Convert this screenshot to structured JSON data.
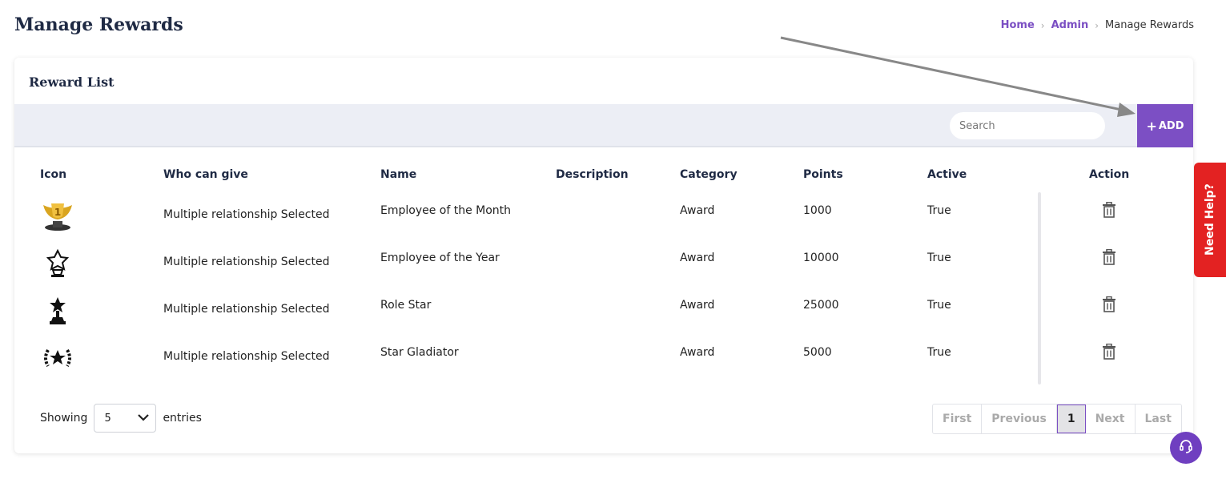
{
  "page": {
    "title": "Manage Rewards"
  },
  "breadcrumb": {
    "home": "Home",
    "admin": "Admin",
    "current": "Manage Rewards",
    "sep": "›"
  },
  "card": {
    "title": "Reward List"
  },
  "search": {
    "placeholder": "Search"
  },
  "toolbar": {
    "add_icon": "+",
    "add_label": "ADD"
  },
  "table": {
    "headers": {
      "icon": "Icon",
      "who": "Who can give",
      "name": "Name",
      "description": "Description",
      "category": "Category",
      "points": "Points",
      "active": "Active",
      "action": "Action"
    },
    "rows": [
      {
        "icon": "gold-trophy-icon",
        "who": "Multiple relationship Selected",
        "name": "Employee of the Month",
        "description": "",
        "category": "Award",
        "points": "1000",
        "active": "True"
      },
      {
        "icon": "star-trophy-icon",
        "who": "Multiple relationship Selected",
        "name": "Employee of the Year",
        "description": "",
        "category": "Award",
        "points": "10000",
        "active": "True"
      },
      {
        "icon": "star-figure-trophy-icon",
        "who": "Multiple relationship Selected",
        "name": "Role Star",
        "description": "",
        "category": "Award",
        "points": "25000",
        "active": "True"
      },
      {
        "icon": "laurel-star-icon",
        "who": "Multiple relationship Selected",
        "name": "Star Gladiator",
        "description": "",
        "category": "Award",
        "points": "5000",
        "active": "True"
      }
    ]
  },
  "footer": {
    "showing": "Showing",
    "entries_value": "5",
    "entries": "entries"
  },
  "pagination": {
    "first": "First",
    "previous": "Previous",
    "current": "1",
    "next": "Next",
    "last": "Last"
  },
  "help": {
    "label": "Need Help?"
  },
  "colors": {
    "accent": "#7c4fc4",
    "help": "#e32222"
  }
}
